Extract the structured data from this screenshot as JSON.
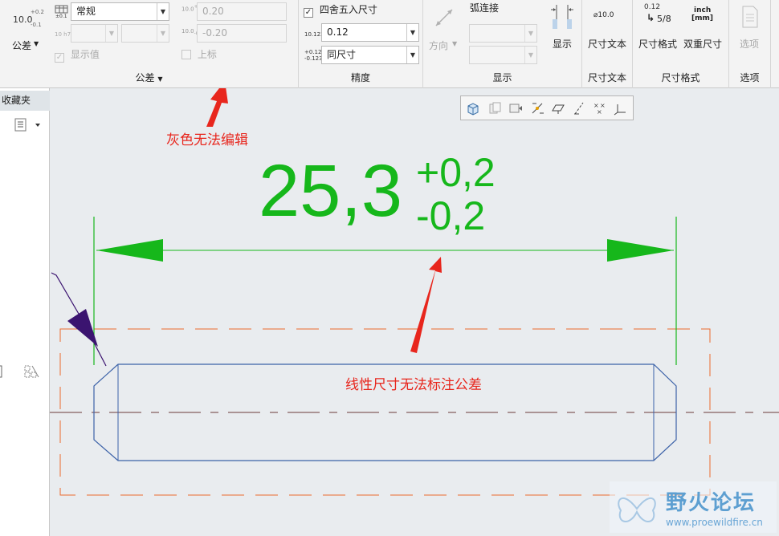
{
  "ribbon": {
    "tolerance_group": {
      "label": "公差",
      "tolerance_button_label": "公差",
      "format_value": "常规",
      "upper_value": "0.20",
      "lower_value": "-0.20",
      "show_value_label": "显示值",
      "upper_check_label": "上标",
      "icon_nominal": "10.0",
      "icon_plus": "+0.2",
      "icon_minus": "-0.1"
    },
    "precision_group": {
      "label": "精度",
      "round_label": "四舍五入尺寸",
      "round_checked": true,
      "decimal_value": "0.12",
      "tolerance_precision_value": "同尺寸"
    },
    "display_group": {
      "label": "显示",
      "direction_label": "方向",
      "arc_label": "弧连接",
      "show_label": "显示"
    },
    "dim_text_group": {
      "label": "尺寸文本",
      "button_label": "尺寸文本",
      "icon_text": "⌀10.0"
    },
    "dim_format_group": {
      "label": "尺寸格式",
      "format_button_label": "尺寸格式",
      "dual_button_label": "双重尺寸",
      "format_icon_value": "0.12",
      "format_icon_fraction": "5/8",
      "dual_icon_top": "inch",
      "dual_icon_bottom": "[mm]"
    },
    "options_group": {
      "label": "选项",
      "button_label": "选项"
    }
  },
  "left_panel": {
    "favorites_label": "收藏夹"
  },
  "drawing": {
    "dimension_main": "25,3",
    "tol_upper": "+0,2",
    "tol_lower": "-0,2"
  },
  "annotations": {
    "gray_note": "灰色无法编辑",
    "linear_note": "线性尺寸无法标注公差"
  },
  "watermark": {
    "brand": "野火论坛",
    "url": "www.proewildfire.cn"
  },
  "colors": {
    "dimension_green": "#16b71b",
    "annotation_red": "#e8261d",
    "part_outline_blue": "#3c62a8",
    "bounding_orange": "#ec6a2c",
    "leader_purple": "#3b1470"
  }
}
